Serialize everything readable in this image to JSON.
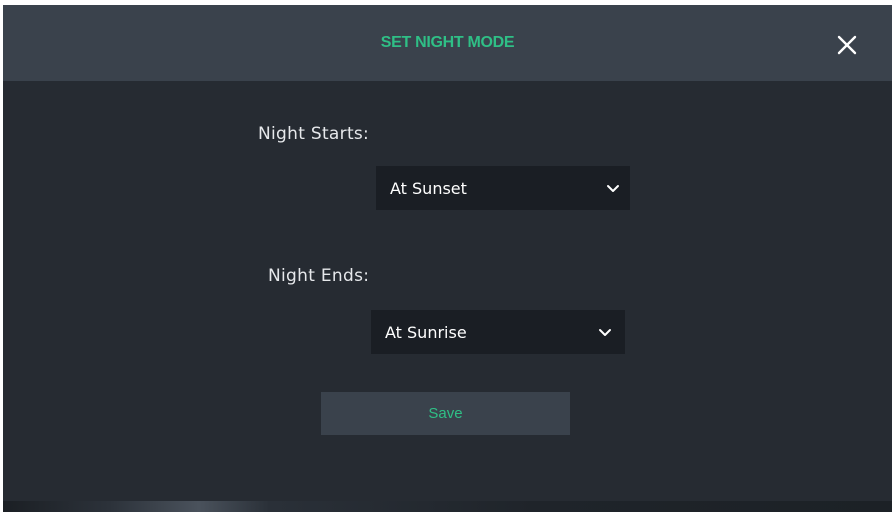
{
  "dialog": {
    "title": "SET NIGHT MODE",
    "close_icon": "close-icon"
  },
  "night_starts": {
    "label": "Night Starts:",
    "selected": "At Sunset",
    "icon": "chevron-down-icon"
  },
  "night_ends": {
    "label": "Night Ends:",
    "selected": "At Sunrise",
    "icon": "chevron-down-icon"
  },
  "save": {
    "label": "Save"
  },
  "colors": {
    "accent": "#2fbf86",
    "header_bg": "#3a424c",
    "dialog_bg": "#262b32",
    "select_bg": "#1a1e24",
    "text": "#e6e8eb"
  }
}
